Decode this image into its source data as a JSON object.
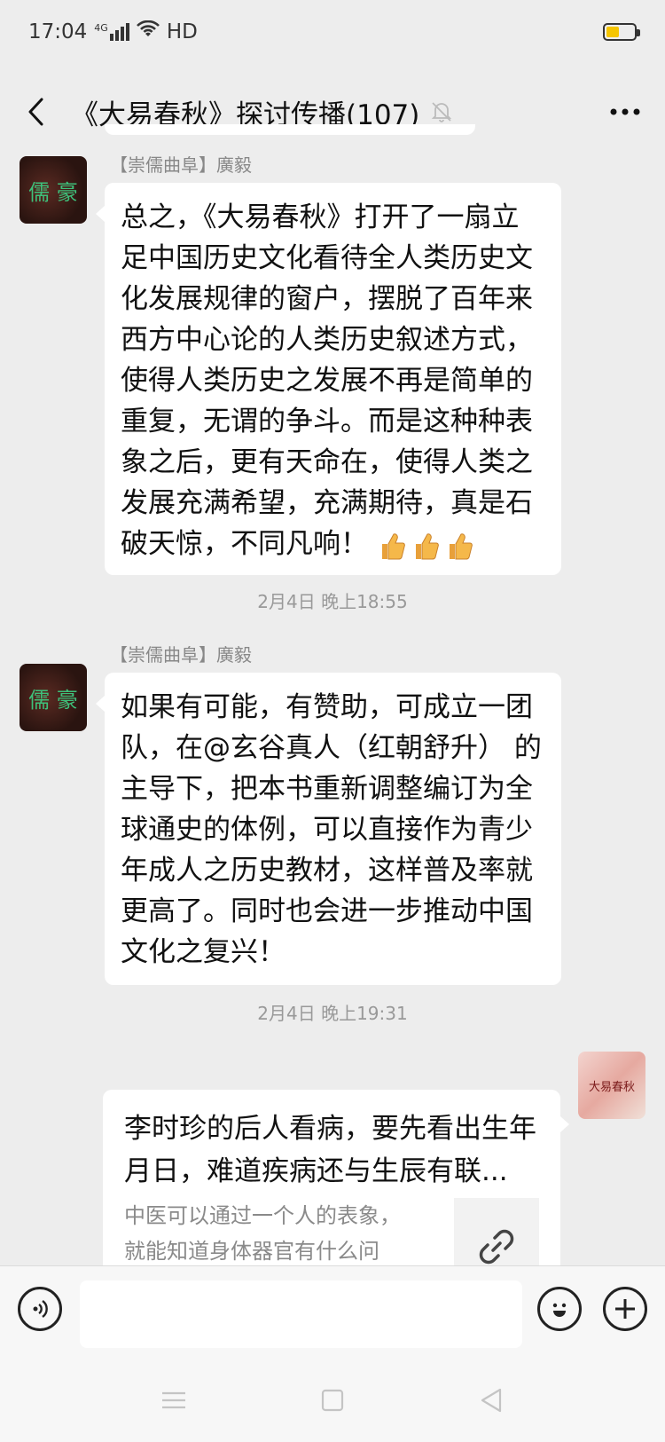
{
  "status": {
    "time": "17:04",
    "network": "4G",
    "hd": "HD",
    "battery_level": 0.4
  },
  "header": {
    "title": "《大易春秋》探讨传播(107)",
    "icons": [
      "back-arrow-icon",
      "mute-bell-icon",
      "more-icon"
    ]
  },
  "messages": [
    {
      "sender": "【崇儒曲阜】廣毅",
      "avatar_text": "儒 豪",
      "text": "总之，《大易春秋》打开了一扇立足中国历史文化看待全人类历史文化发展规律的窗户，摆脱了百年来西方中心论的人类历史叙述方式，使得人类历史之发展不再是简单的重复，无谓的争斗。而是这种种表象之后，更有天命在，使得人类之发展充满希望，充满期待，真是石破天惊，不同凡响！",
      "emoji": [
        "thumbs-up",
        "thumbs-up",
        "thumbs-up"
      ]
    },
    {
      "time": "2月4日 晚上18:55",
      "sender": "【崇儒曲阜】廣毅",
      "avatar_text": "儒 豪",
      "text": "如果有可能，有赞助，可成立一团队，在@玄谷真人（红朝舒升） 的主导下，把本书重新调整编订为全球通史的体例，可以直接作为青少年成人之历史教材，这样普及率就更高了。同时也会进一步推动中国文化之复兴！"
    },
    {
      "time": "2月4日 晚上19:31",
      "link_title": "李时珍的后人看病，要先看出生年月日，难道疾病还与生辰有联...",
      "link_desc": "中医可以通过一个人的表象，就能知道身体器官有什么问",
      "avatar_text": "大易春秋"
    }
  ],
  "input": {
    "placeholder": ""
  },
  "colors": {
    "background": "#ededed",
    "bubble": "#ffffff",
    "timestamp": "#999999",
    "sender": "#888888"
  }
}
